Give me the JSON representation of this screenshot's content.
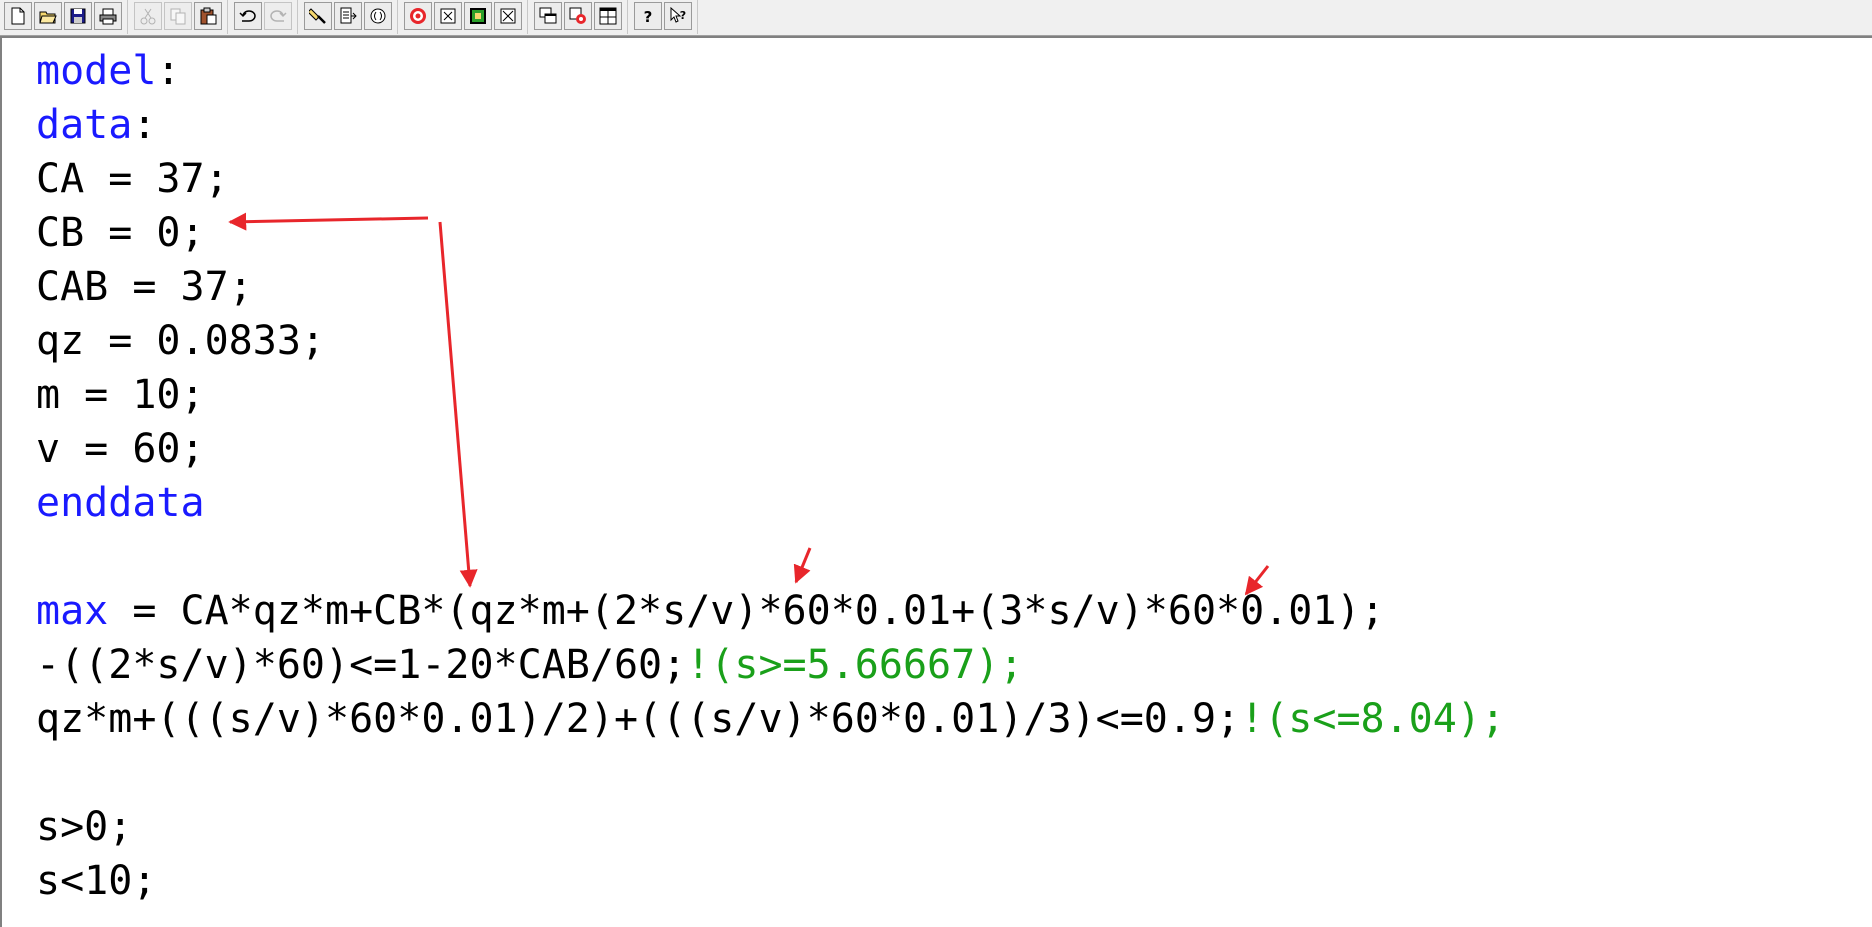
{
  "toolbar": {
    "buttons": [
      {
        "name": "new-file-button",
        "icon": "new-file-icon",
        "enabled": true
      },
      {
        "name": "open-button",
        "icon": "folder-open-icon",
        "enabled": true
      },
      {
        "name": "save-button",
        "icon": "floppy-disk-icon",
        "enabled": true
      },
      {
        "name": "print-button",
        "icon": "printer-icon",
        "enabled": true
      },
      {
        "name": "cut-button",
        "icon": "scissors-icon",
        "enabled": false
      },
      {
        "name": "copy-button",
        "icon": "copy-icon",
        "enabled": false
      },
      {
        "name": "paste-button",
        "icon": "clipboard-icon",
        "enabled": true
      },
      {
        "name": "undo-button",
        "icon": "undo-icon",
        "enabled": true
      },
      {
        "name": "redo-button",
        "icon": "redo-icon",
        "enabled": false
      },
      {
        "name": "find-button",
        "icon": "flashlight-icon",
        "enabled": true
      },
      {
        "name": "goto-line-button",
        "icon": "goto-line-icon",
        "enabled": true
      },
      {
        "name": "match-parenthesis-button",
        "icon": "parenthesis-icon",
        "enabled": true
      },
      {
        "name": "solve-button",
        "icon": "target-icon",
        "enabled": true
      },
      {
        "name": "close-solution-button",
        "icon": "close-box-icon",
        "enabled": true
      },
      {
        "name": "send-to-back-button",
        "icon": "window-back-icon",
        "enabled": true
      },
      {
        "name": "close-window-button",
        "icon": "close-box-icon",
        "enabled": true
      },
      {
        "name": "cascade-button",
        "icon": "cascade-windows-icon",
        "enabled": true
      },
      {
        "name": "options-button",
        "icon": "options-icon",
        "enabled": true
      },
      {
        "name": "tile-button",
        "icon": "tile-windows-icon",
        "enabled": true
      },
      {
        "name": "help-button",
        "icon": "question-icon",
        "enabled": true
      },
      {
        "name": "context-help-button",
        "icon": "pointer-help-icon",
        "enabled": true
      }
    ]
  },
  "editor": {
    "lines": [
      {
        "segments": [
          {
            "text": "model",
            "type": "keyword"
          },
          {
            "text": ":",
            "type": "normal"
          }
        ]
      },
      {
        "segments": [
          {
            "text": "data",
            "type": "keyword"
          },
          {
            "text": ":",
            "type": "normal"
          }
        ]
      },
      {
        "segments": [
          {
            "text": "CA = 37;",
            "type": "normal"
          }
        ]
      },
      {
        "segments": [
          {
            "text": "CB = 0;",
            "type": "normal"
          }
        ]
      },
      {
        "segments": [
          {
            "text": "CAB = 37;",
            "type": "normal"
          }
        ]
      },
      {
        "segments": [
          {
            "text": "qz = 0.0833;",
            "type": "normal"
          }
        ]
      },
      {
        "segments": [
          {
            "text": "m = 10;",
            "type": "normal"
          }
        ]
      },
      {
        "segments": [
          {
            "text": "v = 60;",
            "type": "normal"
          }
        ]
      },
      {
        "segments": [
          {
            "text": "enddata",
            "type": "keyword"
          }
        ]
      },
      {
        "segments": []
      },
      {
        "segments": [
          {
            "text": "max",
            "type": "keyword"
          },
          {
            "text": " = CA*qz*m+CB*(qz*m+(2*s/v)*60*0.01+(3*s/v)*60*0.01);",
            "type": "normal"
          }
        ]
      },
      {
        "segments": [
          {
            "text": "-((2*s/v)*60)<=1-20*CAB/60;",
            "type": "normal"
          },
          {
            "text": "!(s>=5.66667);",
            "type": "comment"
          }
        ]
      },
      {
        "segments": [
          {
            "text": "qz*m+(((s/v)*60*0.01)/2)+(((s/v)*60*0.01)/3)<=0.9;",
            "type": "normal"
          },
          {
            "text": "!(s<=8.04);",
            "type": "comment"
          }
        ]
      },
      {
        "segments": []
      },
      {
        "segments": [
          {
            "text": "s>0;",
            "type": "normal"
          }
        ]
      },
      {
        "segments": [
          {
            "text": "s<10;",
            "type": "normal"
          }
        ]
      }
    ]
  },
  "colors": {
    "keyword": "#1a1aff",
    "comment": "#1aa01a",
    "annotation_arrow": "#e8262b"
  }
}
